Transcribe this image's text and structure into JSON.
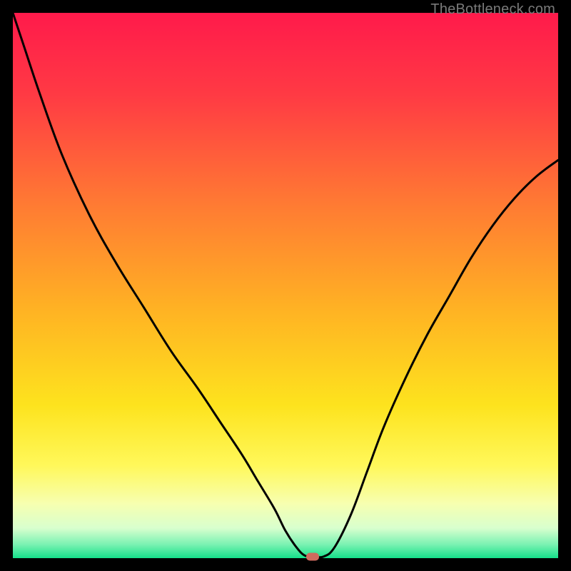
{
  "watermark": "TheBottleneck.com",
  "marker_color": "#cf6a5e",
  "chart_data": {
    "type": "line",
    "title": "",
    "xlabel": "",
    "ylabel": "",
    "xlim": [
      0,
      100
    ],
    "ylim": [
      0,
      100
    ],
    "gradient_stops": [
      {
        "offset": 0.0,
        "color": "#ff1a4b"
      },
      {
        "offset": 0.15,
        "color": "#ff3a44"
      },
      {
        "offset": 0.35,
        "color": "#ff7a33"
      },
      {
        "offset": 0.55,
        "color": "#ffb423"
      },
      {
        "offset": 0.72,
        "color": "#fde31e"
      },
      {
        "offset": 0.83,
        "color": "#fff85a"
      },
      {
        "offset": 0.9,
        "color": "#f7ffb0"
      },
      {
        "offset": 0.945,
        "color": "#d8ffce"
      },
      {
        "offset": 0.975,
        "color": "#7af2b2"
      },
      {
        "offset": 1.0,
        "color": "#15e08a"
      }
    ],
    "series": [
      {
        "name": "bottleneck-curve",
        "x": [
          0.0,
          2.0,
          5.0,
          9.0,
          14.0,
          19.0,
          24.0,
          29.0,
          34.0,
          38.0,
          42.0,
          45.0,
          48.0,
          50.0,
          52.0,
          53.5,
          55.0,
          57.0,
          59.0,
          62.0,
          65.0,
          68.0,
          72.0,
          76.0,
          80.0,
          84.0,
          88.0,
          92.0,
          96.0,
          100.0
        ],
        "y": [
          100.0,
          94.0,
          85.0,
          74.0,
          63.0,
          54.0,
          46.0,
          38.0,
          31.0,
          25.0,
          19.0,
          14.0,
          9.0,
          5.0,
          2.0,
          0.5,
          0.3,
          0.3,
          2.0,
          8.0,
          16.0,
          24.0,
          33.0,
          41.0,
          48.0,
          55.0,
          61.0,
          66.0,
          70.0,
          73.0
        ]
      }
    ],
    "marker": {
      "x": 55.0,
      "y": 0.3
    }
  }
}
